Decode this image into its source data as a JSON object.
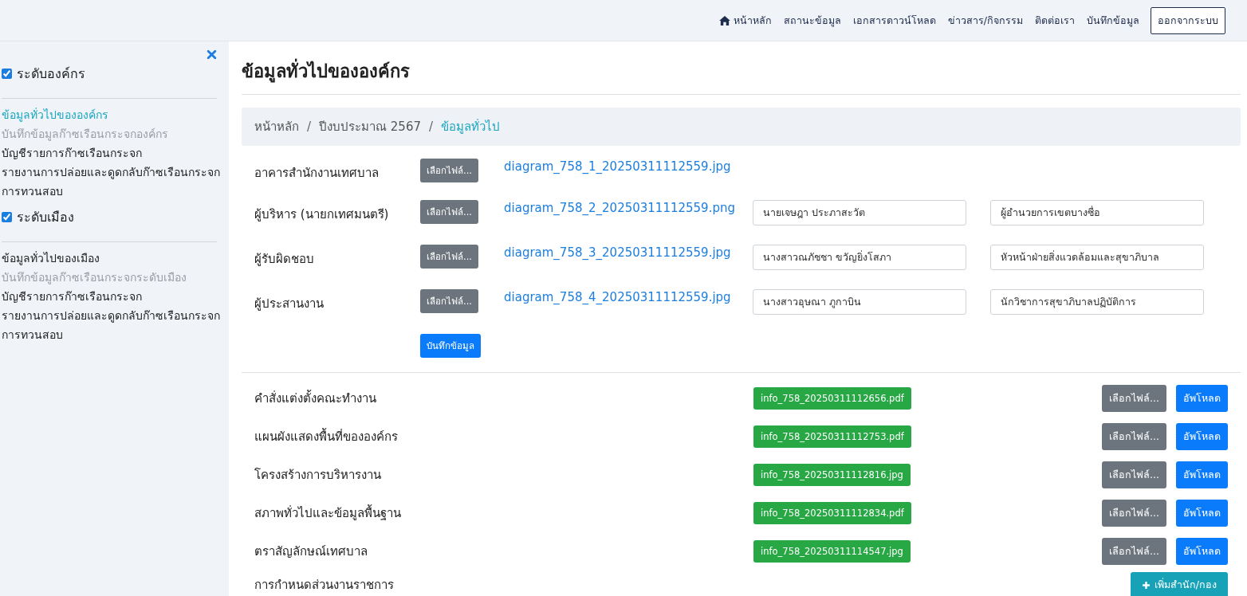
{
  "nav": {
    "items": [
      {
        "label": "หน้าหลัก"
      },
      {
        "label": "สถานะข้อมูล"
      },
      {
        "label": "เอกสารดาวน์โหลด"
      },
      {
        "label": "ข่าวสาร/กิจกรรม"
      },
      {
        "label": "ติดต่อเรา"
      },
      {
        "label": "บันทึกข้อมูล"
      }
    ],
    "logout": "ออกจากระบบ"
  },
  "sidebar": {
    "sections": [
      {
        "title": "ระดับองค์กร",
        "checked": true,
        "items": [
          {
            "label": "ข้อมูลทั่วไปขององค์กร",
            "selected": true,
            "disabled": false
          },
          {
            "label": "บันทึกข้อมูลก๊าซเรือนกระจกองค์กร",
            "selected": false,
            "disabled": true
          },
          {
            "label": "บัญชีรายการก๊าซเรือนกระจก",
            "selected": false,
            "disabled": false
          },
          {
            "label": "รายงานการปล่อยและดูดกลับก๊าซเรือนกระจก",
            "selected": false,
            "disabled": false
          },
          {
            "label": "การทวนสอบ",
            "selected": false,
            "disabled": false
          }
        ]
      },
      {
        "title": "ระดับเมือง",
        "checked": true,
        "items": [
          {
            "label": "ข้อมูลทั่วไปของเมือง",
            "selected": false,
            "disabled": false
          },
          {
            "label": "บันทึกข้อมูลก๊าซเรือนกระจกระดับเมือง",
            "selected": false,
            "disabled": true
          },
          {
            "label": "บัญชีรายการก๊าซเรือนกระจก",
            "selected": false,
            "disabled": false
          },
          {
            "label": "รายงานการปล่อยและดูดกลับก๊าซเรือนกระจก",
            "selected": false,
            "disabled": false
          },
          {
            "label": "การทวนสอบ",
            "selected": false,
            "disabled": false
          }
        ]
      }
    ]
  },
  "page_title": "ข้อมูลทั่วไปขององค์กร",
  "breadcrumb": {
    "separator": "/",
    "items": [
      {
        "label": "หน้าหลัก",
        "selected": false
      },
      {
        "label": "ปีงบประมาณ 2567",
        "selected": false
      },
      {
        "label": "ข้อมูลทั่วไป",
        "selected": true
      }
    ]
  },
  "people": [
    {
      "label": "อาคารสำนักงานเทศบาล",
      "button": "เลือกไฟล์...",
      "file": "diagram_758_1_20250311112559.jpg"
    },
    {
      "label": "ผู้บริหาร (นายกเทศมนตรี)",
      "button": "เลือกไฟล์...",
      "file": "diagram_758_2_20250311112559.png",
      "name": "นายเจษฎา ประภาสะวัต",
      "position": "ผู้อำนวยการเขตบางซื่อ"
    },
    {
      "label": "ผู้รับผิดชอบ",
      "button": "เลือกไฟล์...",
      "file": "diagram_758_3_20250311112559.jpg",
      "name": "นางสาวณภัชชา ขวัญยิ่งโสภา",
      "position": "หัวหน้าฝ่ายสิ่งแวดล้อมและสุขาภิบาล"
    },
    {
      "label": "ผู้ประสานงาน",
      "button": "เลือกไฟล์...",
      "file": "diagram_758_4_20250311112559.jpg",
      "name": "นางสาวอุษณา ภูกาบิน",
      "position": "นักวิชาการสุขาภิบาลปฏิบัติการ"
    }
  ],
  "save_button": "บันทึกข้อมูล",
  "documents": [
    {
      "label": "คำสั่งแต่งตั้งคณะทำงาน",
      "file": "info_758_20250311112656.pdf",
      "choose": "เลือกไฟล์...",
      "upload": "อัพโหลด"
    },
    {
      "label": "แผนผังแสดงพื้นที่ขององค์กร",
      "file": "info_758_20250311112753.pdf",
      "choose": "เลือกไฟล์...",
      "upload": "อัพโหลด"
    },
    {
      "label": "โครงสร้างการบริหารงาน",
      "file": "info_758_20250311112816.jpg",
      "choose": "เลือกไฟล์...",
      "upload": "อัพโหลด"
    },
    {
      "label": "สภาพทั่วไปและข้อมูลพื้นฐาน",
      "file": "info_758_20250311112834.pdf",
      "choose": "เลือกไฟล์...",
      "upload": "อัพโหลด"
    },
    {
      "label": "ตราสัญลักษณ์เทศบาล",
      "file": "info_758_20250311114547.jpg",
      "choose": "เลือกไฟล์...",
      "upload": "อัพโหลด"
    }
  ],
  "departments": {
    "label": "การกำหนดส่วนงานราชการ",
    "button": "เพิ่มสำนัก/กอง"
  }
}
